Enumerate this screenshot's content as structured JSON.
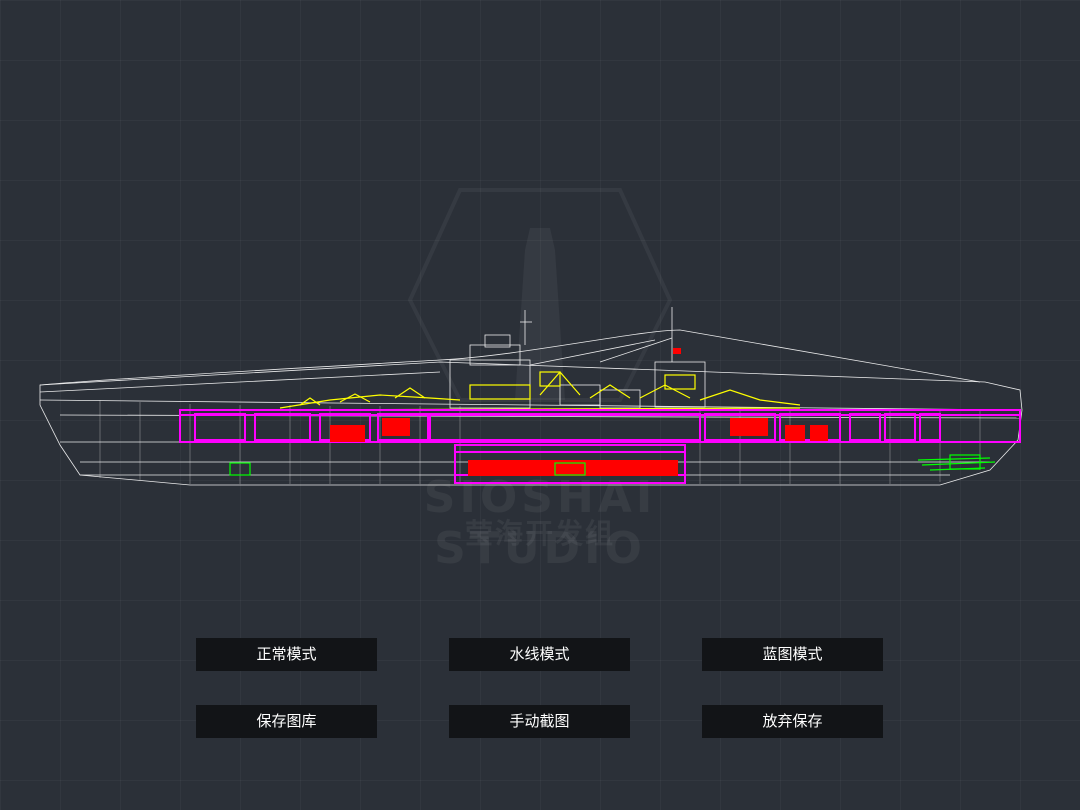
{
  "watermark": {
    "studio": "SIOSHAI STUDIO",
    "group": "莹海开发组"
  },
  "colors": {
    "background": "#2b3038",
    "wireframe": "#ffffff",
    "armor": "#ff00ff",
    "machinery": "#ff0000",
    "armament": "#ffff00",
    "auxiliary": "#00ff00",
    "button_bg": "#121417"
  },
  "buttons": {
    "normal_mode": "正常模式",
    "waterline_mode": "水线模式",
    "blueprint_mode": "蓝图模式",
    "save_gallery": "保存图库",
    "manual_screenshot": "手动截图",
    "discard_save": "放弃保存"
  }
}
